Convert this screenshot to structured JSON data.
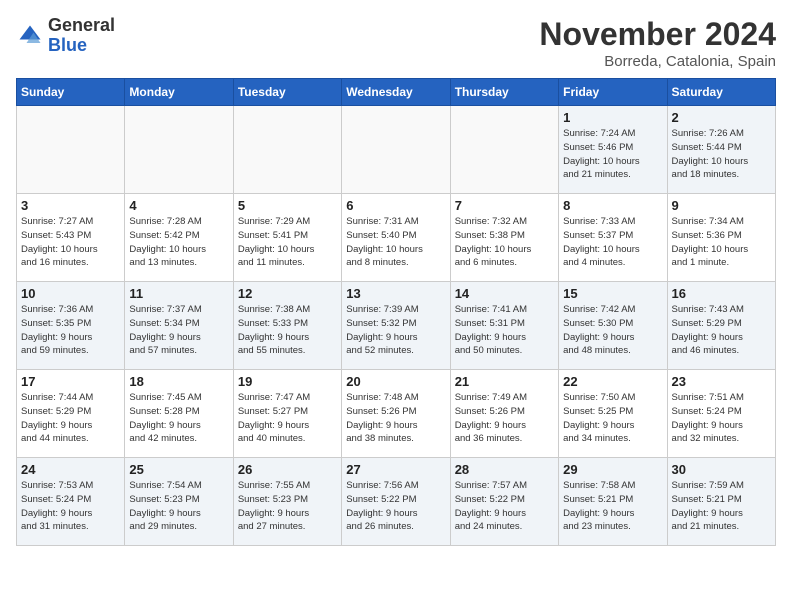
{
  "header": {
    "logo_general": "General",
    "logo_blue": "Blue",
    "month_title": "November 2024",
    "location": "Borreda, Catalonia, Spain"
  },
  "weekdays": [
    "Sunday",
    "Monday",
    "Tuesday",
    "Wednesday",
    "Thursday",
    "Friday",
    "Saturday"
  ],
  "weeks": [
    [
      {
        "day": "",
        "info": ""
      },
      {
        "day": "",
        "info": ""
      },
      {
        "day": "",
        "info": ""
      },
      {
        "day": "",
        "info": ""
      },
      {
        "day": "",
        "info": ""
      },
      {
        "day": "1",
        "info": "Sunrise: 7:24 AM\nSunset: 5:46 PM\nDaylight: 10 hours\nand 21 minutes."
      },
      {
        "day": "2",
        "info": "Sunrise: 7:26 AM\nSunset: 5:44 PM\nDaylight: 10 hours\nand 18 minutes."
      }
    ],
    [
      {
        "day": "3",
        "info": "Sunrise: 7:27 AM\nSunset: 5:43 PM\nDaylight: 10 hours\nand 16 minutes."
      },
      {
        "day": "4",
        "info": "Sunrise: 7:28 AM\nSunset: 5:42 PM\nDaylight: 10 hours\nand 13 minutes."
      },
      {
        "day": "5",
        "info": "Sunrise: 7:29 AM\nSunset: 5:41 PM\nDaylight: 10 hours\nand 11 minutes."
      },
      {
        "day": "6",
        "info": "Sunrise: 7:31 AM\nSunset: 5:40 PM\nDaylight: 10 hours\nand 8 minutes."
      },
      {
        "day": "7",
        "info": "Sunrise: 7:32 AM\nSunset: 5:38 PM\nDaylight: 10 hours\nand 6 minutes."
      },
      {
        "day": "8",
        "info": "Sunrise: 7:33 AM\nSunset: 5:37 PM\nDaylight: 10 hours\nand 4 minutes."
      },
      {
        "day": "9",
        "info": "Sunrise: 7:34 AM\nSunset: 5:36 PM\nDaylight: 10 hours\nand 1 minute."
      }
    ],
    [
      {
        "day": "10",
        "info": "Sunrise: 7:36 AM\nSunset: 5:35 PM\nDaylight: 9 hours\nand 59 minutes."
      },
      {
        "day": "11",
        "info": "Sunrise: 7:37 AM\nSunset: 5:34 PM\nDaylight: 9 hours\nand 57 minutes."
      },
      {
        "day": "12",
        "info": "Sunrise: 7:38 AM\nSunset: 5:33 PM\nDaylight: 9 hours\nand 55 minutes."
      },
      {
        "day": "13",
        "info": "Sunrise: 7:39 AM\nSunset: 5:32 PM\nDaylight: 9 hours\nand 52 minutes."
      },
      {
        "day": "14",
        "info": "Sunrise: 7:41 AM\nSunset: 5:31 PM\nDaylight: 9 hours\nand 50 minutes."
      },
      {
        "day": "15",
        "info": "Sunrise: 7:42 AM\nSunset: 5:30 PM\nDaylight: 9 hours\nand 48 minutes."
      },
      {
        "day": "16",
        "info": "Sunrise: 7:43 AM\nSunset: 5:29 PM\nDaylight: 9 hours\nand 46 minutes."
      }
    ],
    [
      {
        "day": "17",
        "info": "Sunrise: 7:44 AM\nSunset: 5:29 PM\nDaylight: 9 hours\nand 44 minutes."
      },
      {
        "day": "18",
        "info": "Sunrise: 7:45 AM\nSunset: 5:28 PM\nDaylight: 9 hours\nand 42 minutes."
      },
      {
        "day": "19",
        "info": "Sunrise: 7:47 AM\nSunset: 5:27 PM\nDaylight: 9 hours\nand 40 minutes."
      },
      {
        "day": "20",
        "info": "Sunrise: 7:48 AM\nSunset: 5:26 PM\nDaylight: 9 hours\nand 38 minutes."
      },
      {
        "day": "21",
        "info": "Sunrise: 7:49 AM\nSunset: 5:26 PM\nDaylight: 9 hours\nand 36 minutes."
      },
      {
        "day": "22",
        "info": "Sunrise: 7:50 AM\nSunset: 5:25 PM\nDaylight: 9 hours\nand 34 minutes."
      },
      {
        "day": "23",
        "info": "Sunrise: 7:51 AM\nSunset: 5:24 PM\nDaylight: 9 hours\nand 32 minutes."
      }
    ],
    [
      {
        "day": "24",
        "info": "Sunrise: 7:53 AM\nSunset: 5:24 PM\nDaylight: 9 hours\nand 31 minutes."
      },
      {
        "day": "25",
        "info": "Sunrise: 7:54 AM\nSunset: 5:23 PM\nDaylight: 9 hours\nand 29 minutes."
      },
      {
        "day": "26",
        "info": "Sunrise: 7:55 AM\nSunset: 5:23 PM\nDaylight: 9 hours\nand 27 minutes."
      },
      {
        "day": "27",
        "info": "Sunrise: 7:56 AM\nSunset: 5:22 PM\nDaylight: 9 hours\nand 26 minutes."
      },
      {
        "day": "28",
        "info": "Sunrise: 7:57 AM\nSunset: 5:22 PM\nDaylight: 9 hours\nand 24 minutes."
      },
      {
        "day": "29",
        "info": "Sunrise: 7:58 AM\nSunset: 5:21 PM\nDaylight: 9 hours\nand 23 minutes."
      },
      {
        "day": "30",
        "info": "Sunrise: 7:59 AM\nSunset: 5:21 PM\nDaylight: 9 hours\nand 21 minutes."
      }
    ]
  ],
  "row_styles": [
    "shaded",
    "white",
    "shaded",
    "white",
    "shaded"
  ]
}
